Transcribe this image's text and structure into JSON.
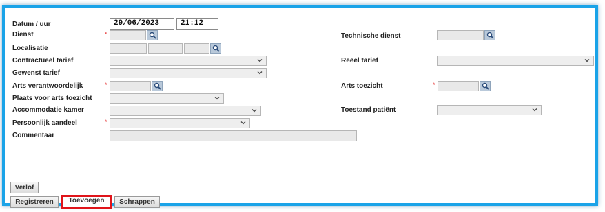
{
  "fields": {
    "datum_label": "Datum / uur",
    "date_value": "29/06/2023",
    "time_value": "21:12",
    "dienst_label": "Dienst",
    "localisatie_label": "Localisatie",
    "contractueel_label": "Contractueel tarief",
    "gewenst_label": "Gewenst tarief",
    "arts_verantwoordelijk_label": "Arts verantwoordelijk",
    "plaats_label": "Plaats voor arts toezicht",
    "accommodatie_label": "Accommodatie kamer",
    "persoonlijk_label": "Persoonlijk aandeel",
    "commentaar_label": "Commentaar",
    "technische_dienst_label": "Technische dienst",
    "reeel_label": "Reëel tarief",
    "arts_toezicht_label": "Arts toezicht",
    "toestand_label": "Toestand patiënt",
    "required_marker": "*"
  },
  "buttons": {
    "verlof": "Verlof",
    "registreren": "Registreren",
    "toevoegen": "Toevoegen",
    "schrappen": "Schrappen"
  },
  "icons": {
    "lookup": "magnifier-icon",
    "dropdown": "chevron-down-icon"
  },
  "colors": {
    "frame_border": "#1aa3e8",
    "highlight": "#e0141a",
    "required": "#e53030"
  }
}
